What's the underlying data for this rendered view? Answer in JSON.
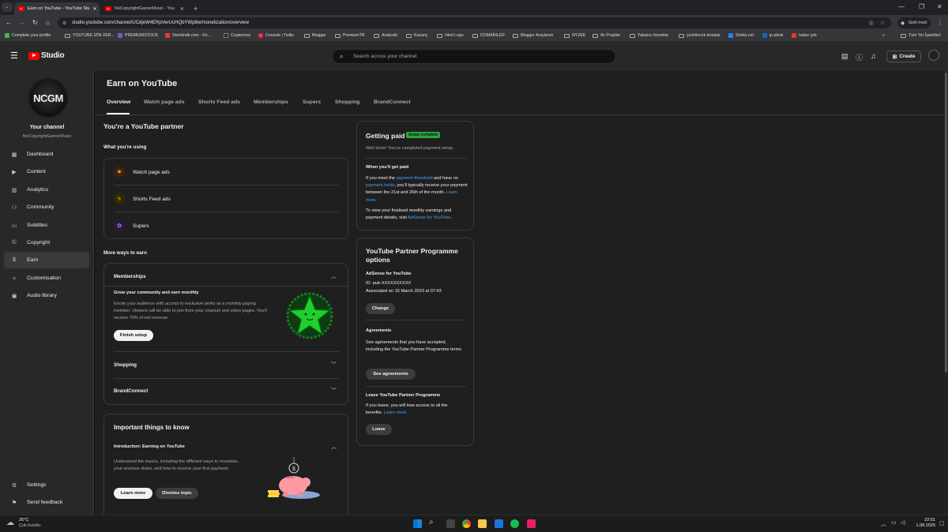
{
  "browser": {
    "tabs": [
      {
        "title": "Earn on YouTube - YouTube Stu",
        "active": true
      },
      {
        "title": "NoCopyrightGamerMusic - You",
        "active": false
      }
    ],
    "url": "studio.youtube.com/channel/UCdjeW4ERpVerUcHQbYWp8w/monetization/overview",
    "incognito_label": "Gizli mod",
    "bookmarks": [
      "Complete your profile",
      "YOUTUBE İZİN VER...",
      "PREMIUMSTOCK",
      "Stockindir.com - Ko...",
      "Cryptomus",
      "Console | Twilio",
      "Blogger",
      "PremiumTR",
      "Analystic",
      "Kazanç",
      "Html Logo",
      "DOMAİNLER",
      "Blogger Araçlarım",
      "NYZEE",
      "Av Projeler",
      "Yabancı forumlar",
      "çevirilecek temalar",
      "Stokla.net",
      "ip plesk",
      "haber çek"
    ],
    "all_bookmarks": "Tüm Yer İşaretleri"
  },
  "header": {
    "logo_text": "Studio",
    "search_placeholder": "Search across your channel",
    "create_label": "Create"
  },
  "sidebar": {
    "avatar_text": "NCGM",
    "channel_title": "Your channel",
    "channel_name": "NoCopyrightGamerMusic",
    "items": [
      {
        "label": "Dashboard",
        "icon": "dashboard-icon"
      },
      {
        "label": "Content",
        "icon": "content-icon"
      },
      {
        "label": "Analytics",
        "icon": "analytics-icon"
      },
      {
        "label": "Community",
        "icon": "community-icon"
      },
      {
        "label": "Subtitles",
        "icon": "subtitles-icon"
      },
      {
        "label": "Copyright",
        "icon": "copyright-icon"
      },
      {
        "label": "Earn",
        "icon": "dollar-icon",
        "active": true
      },
      {
        "label": "Customisation",
        "icon": "magic-wand-icon"
      },
      {
        "label": "Audio library",
        "icon": "audio-library-icon"
      }
    ],
    "settings": "Settings",
    "feedback": "Send feedback"
  },
  "page": {
    "title": "Earn on YouTube",
    "tabs": [
      "Overview",
      "Watch page ads",
      "Shorts Feed ads",
      "Memberships",
      "Supers",
      "Shopping",
      "BrandConnect"
    ],
    "partner_heading": "You're a YouTube partner",
    "using_heading": "What you're using",
    "using_items": [
      "Watch page ads",
      "Shorts Feed ads",
      "Supers"
    ],
    "more_heading": "More ways to earn",
    "memberships": {
      "title": "Memberships",
      "subtitle": "Grow your community and earn monthly",
      "desc": "Excite your audience with access to exclusive perks as a monthly paying member. Viewers will be able to join from your channel and video pages. You'll receive 70% of net revenue.",
      "button": "Finish setup"
    },
    "shopping": "Shopping",
    "brandconnect": "BrandConnect",
    "important": {
      "title": "Important things to know",
      "intro_title": "Introduction: Earning on YouTube",
      "intro_desc": "Understand the basics, including the different ways to monetise, your revenue share, and how to receive your first payment.",
      "learn_more": "Learn more",
      "dismiss": "Dismiss topic"
    }
  },
  "getting_paid": {
    "title": "Getting paid",
    "badge": "Setup complete",
    "done_text": "Well done! You've completed payment setup.",
    "when_heading": "When you'll get paid",
    "when_p1": "If you meet the ",
    "when_link1": "payment threshold",
    "when_p2": " and have no ",
    "when_link2": "payment holds",
    "when_p3": ", you'll typically receive your payment between the 21st and 26th of the month. ",
    "when_link3": "Learn more",
    "view_p1": "To view your finalised monthly earnings and payment details, visit ",
    "view_link": "AdSense for YouTube",
    "view_p2": "."
  },
  "ypp": {
    "title": "YouTube Partner Programme options",
    "adsense_heading": "AdSense for YouTube",
    "adsense_id": "ID: pub-XXXXXXXXXX",
    "adsense_date": "Associated on 15 March 2023 at 07:43",
    "change": "Change",
    "agreements_heading": "Agreements",
    "agreements_desc": "See agreements that you have accepted, including the YouTube Partner Programme terms",
    "see_agreements": "See agreements",
    "leave_heading": "Leave YouTube Partner Programme",
    "leave_desc": "If you leave, you will lose access to all the benefits. ",
    "leave_link": "Learn more",
    "leave": "Leave"
  },
  "taskbar": {
    "weather_temp": "25°C",
    "weather_desc": "Çok bulutlu",
    "time": "22:51",
    "date": "1.08.2025"
  },
  "colors": {
    "accent": "#3ea6ff",
    "brand": "#ff0000",
    "badge": "#2ba640"
  }
}
